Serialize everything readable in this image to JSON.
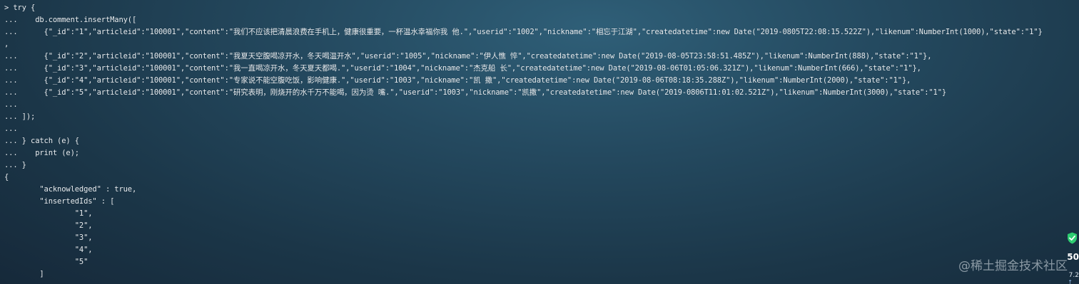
{
  "terminal": {
    "lines": [
      "> try {",
      "...    db.comment.insertMany([",
      "...      {\"_id\":\"1\",\"articleid\":\"100001\",\"content\":\"我们不应该把清晨浪费在手机上，健康很重要，一杯温水幸福你我 他.\",\"userid\":\"1002\",\"nickname\":\"相忘于江湖\",\"createdatetime\":new Date(\"2019-0805T22:08:15.522Z\"),\"likenum\":NumberInt(1000),\"state\":\"1\"}",
      ",",
      "...      {\"_id\":\"2\",\"articleid\":\"100001\",\"content\":\"我夏天空腹喝凉开水，冬天喝温开水\",\"userid\":\"1005\",\"nickname\":\"伊人憔 悴\",\"createdatetime\":new Date(\"2019-08-05T23:58:51.485Z\"),\"likenum\":NumberInt(888),\"state\":\"1\"},",
      "...      {\"_id\":\"3\",\"articleid\":\"100001\",\"content\":\"我一直喝凉开水，冬天夏天都喝.\",\"userid\":\"1004\",\"nickname\":\"杰克船 长\",\"createdatetime\":new Date(\"2019-08-06T01:05:06.321Z\"),\"likenum\":NumberInt(666),\"state\":\"1\"},",
      "...      {\"_id\":\"4\",\"articleid\":\"100001\",\"content\":\"专家说不能空腹吃饭，影响健康.\",\"userid\":\"1003\",\"nickname\":\"凯 撒\",\"createdatetime\":new Date(\"2019-08-06T08:18:35.288Z\"),\"likenum\":NumberInt(2000),\"state\":\"1\"},",
      "...      {\"_id\":\"5\",\"articleid\":\"100001\",\"content\":\"研究表明，刚烧开的水千万不能喝，因为烫 嘴.\",\"userid\":\"1003\",\"nickname\":\"凯撒\",\"createdatetime\":new Date(\"2019-0806T11:01:02.521Z\"),\"likenum\":NumberInt(3000),\"state\":\"1\"}",
      "...",
      "... ]);",
      "...",
      "... } catch (e) {",
      "...    print (e);",
      "... }",
      "{",
      "        \"acknowledged\" : true,",
      "        \"insertedIds\" : [",
      "                \"1\",",
      "                \"2\",",
      "                \"3\",",
      "                \"4\",",
      "                \"5\"",
      "        ]",
      "}"
    ]
  },
  "watermark": {
    "text": "@稀土掘金技术社区"
  },
  "side_widget": {
    "icon": "shield-check-icon",
    "value": "50",
    "sub_value": "7.2",
    "arrow": "↑",
    "accent_color": "#2ecc71"
  }
}
